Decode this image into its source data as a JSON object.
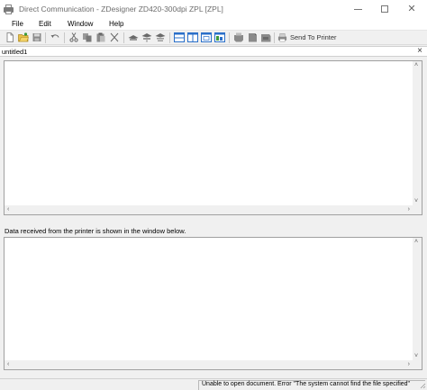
{
  "window": {
    "title": "Direct Communication - ZDesigner ZD420-300dpi ZPL [ZPL]"
  },
  "menu": [
    {
      "label": "File"
    },
    {
      "label": "Edit"
    },
    {
      "label": "Window"
    },
    {
      "label": "Help"
    }
  ],
  "toolbar": {
    "send_label": "Send To Printer",
    "icons": [
      "new-document-icon",
      "open-folder-icon",
      "save-icon",
      "undo-icon",
      "cut-icon",
      "copy-icon",
      "paste-icon",
      "delete-icon",
      "receive-icon",
      "send-icon",
      "send-receive-icon",
      "tile-horizontal-icon",
      "tile-vertical-icon",
      "cascade-icon",
      "arrange-icon",
      "printer-icon",
      "printer-2-icon",
      "printer-3-icon",
      "printer-4-icon",
      "send-to-printer-icon"
    ]
  },
  "document": {
    "tab_title": "untitled1"
  },
  "receive": {
    "label": "Data received from the printer is shown in the window below."
  },
  "status": {
    "message": "Unable to open document. Error \"The system cannot find the file specified\""
  },
  "colors": {
    "toolbar_blue": "#2a6fc9",
    "icon_gray": "#707070",
    "pane_bg": "#ffffff",
    "chrome_bg": "#f0f0f0"
  }
}
